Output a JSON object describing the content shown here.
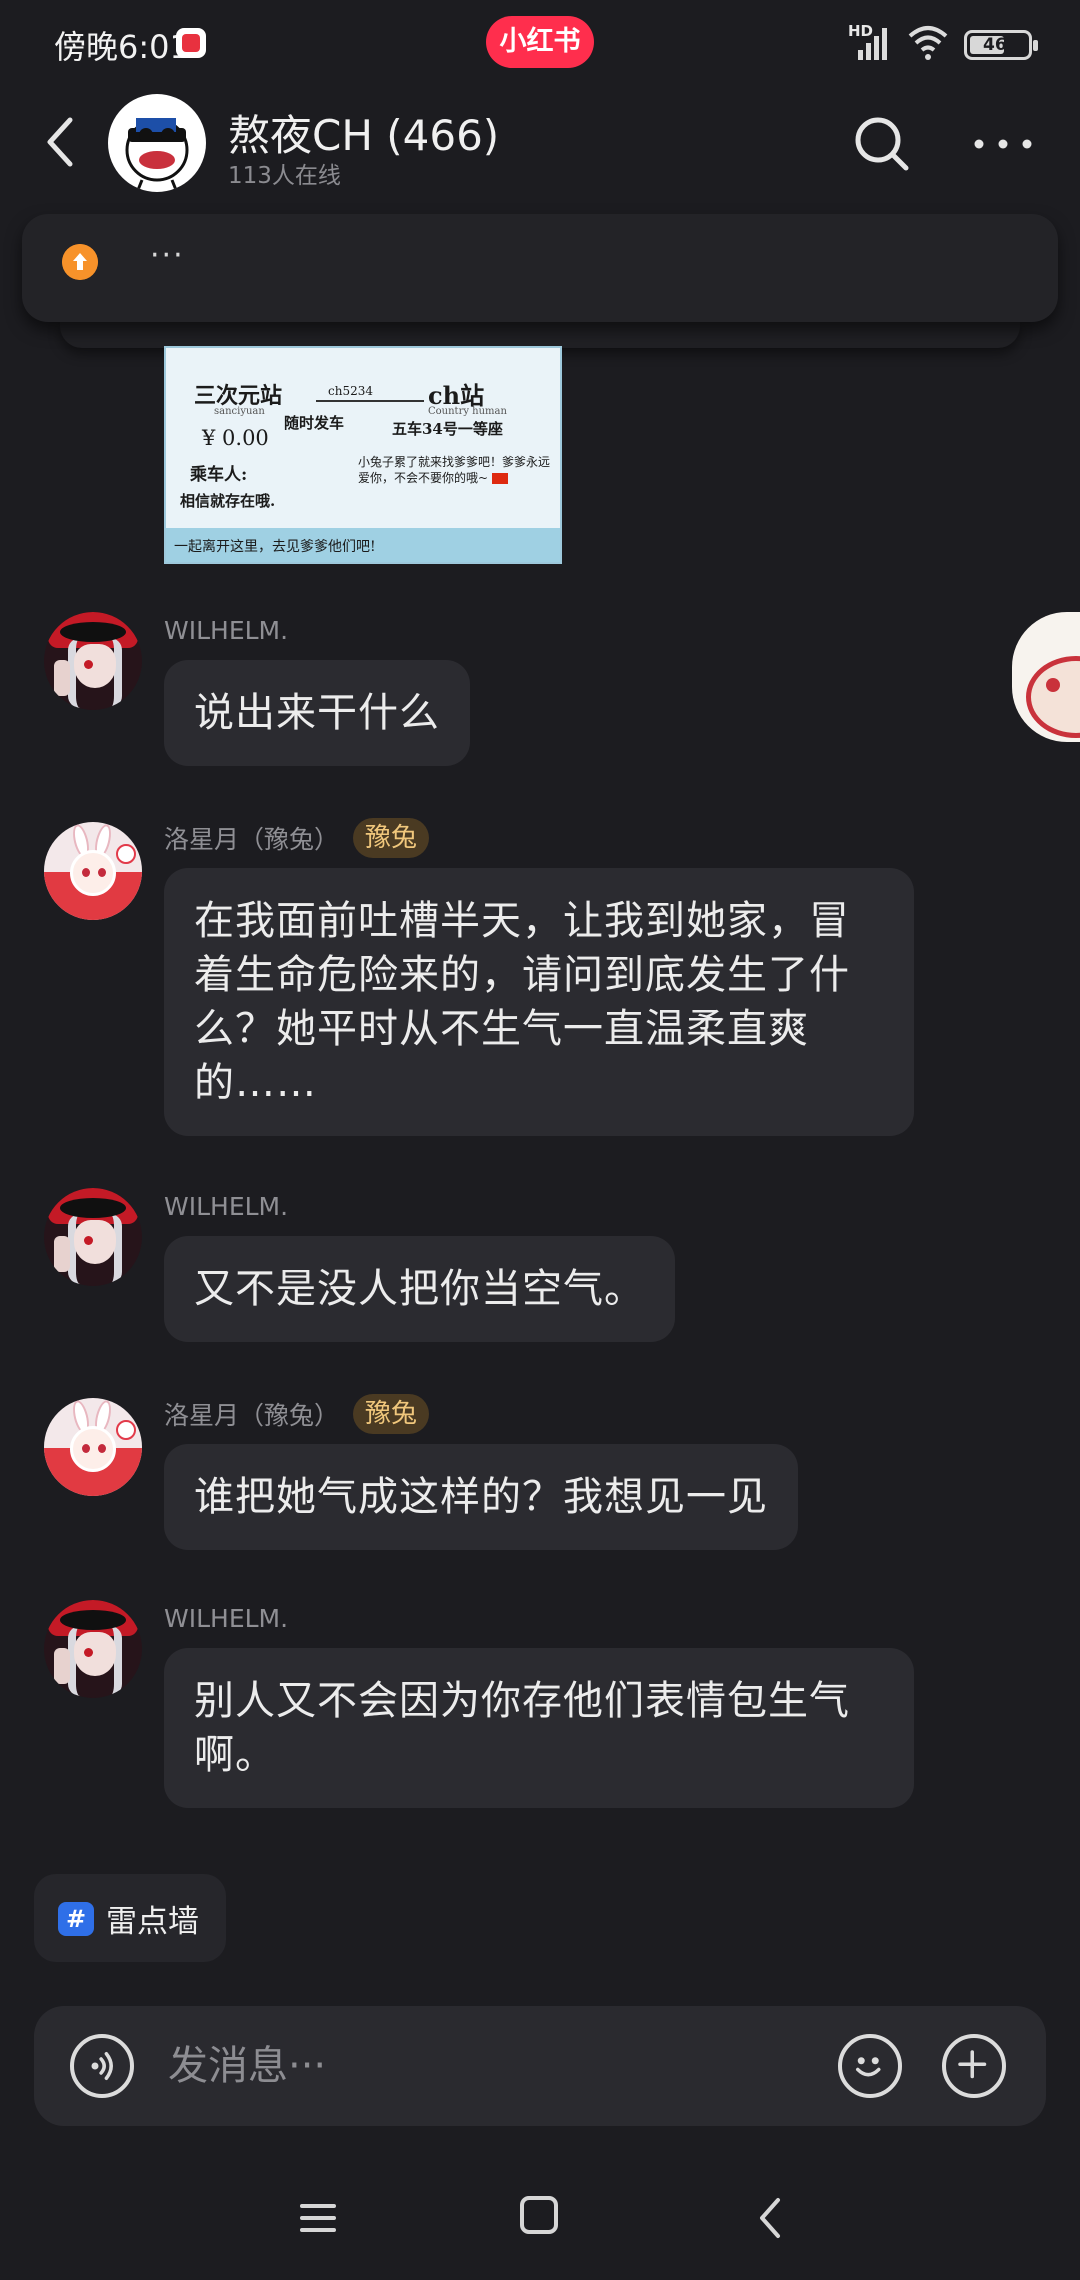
{
  "status_bar": {
    "time": "傍晚6:01",
    "app_badge": "小红书",
    "network": "HD",
    "battery": "46"
  },
  "header": {
    "title": "熬夜CH (466)",
    "online": "113人在线"
  },
  "pinned": {
    "text": "···"
  },
  "ticket": {
    "from": "三次元站",
    "from_sub": "sanciyuan",
    "code": "ch5234",
    "departure": "随时发车",
    "to": "ch站",
    "to_sub": "Country human",
    "seat": "五车34号一等座",
    "price": "¥ 0.00",
    "passenger_label": "乘车人:",
    "passenger": "相信就存在哦.",
    "note": "小兔子累了就来找爹爹吧！爹爹永远爱你，不会不要你的哦~",
    "footer": "一起离开这里，去见爹爹他们吧!"
  },
  "messages": [
    {
      "sender": "WILHELM.",
      "badge": "",
      "text": "说出来干什么"
    },
    {
      "sender": "洛星月（豫兔）",
      "badge": "豫兔",
      "text": "在我面前吐槽半天，让我到她家，冒着生命危险来的，请问到底发生了什么？她平时从不生气一直温柔直爽的……"
    },
    {
      "sender": "WILHELM.",
      "badge": "",
      "text": "又不是没人把你当空气。"
    },
    {
      "sender": "洛星月（豫兔）",
      "badge": "豫兔",
      "text": "谁把她气成这样的？我想见一见"
    },
    {
      "sender": "WILHELM.",
      "badge": "",
      "text": "别人又不会因为你存他们表情包生气啊。"
    }
  ],
  "topic": {
    "icon_char": "#",
    "label": "雷点墙"
  },
  "composer": {
    "placeholder": "发消息···"
  },
  "icons": {
    "back": "chevron-left-icon",
    "search": "search-icon",
    "more": "more-dots-icon",
    "voice": "voice-icon",
    "emoji": "emoji-icon",
    "plus": "plus-icon"
  },
  "colors": {
    "background": "#1c1c20",
    "bubble": "#2b2b30",
    "brand": "#ff2e4d",
    "badge_text": "#f0c77c",
    "topic_icon": "#2f6fe8"
  }
}
